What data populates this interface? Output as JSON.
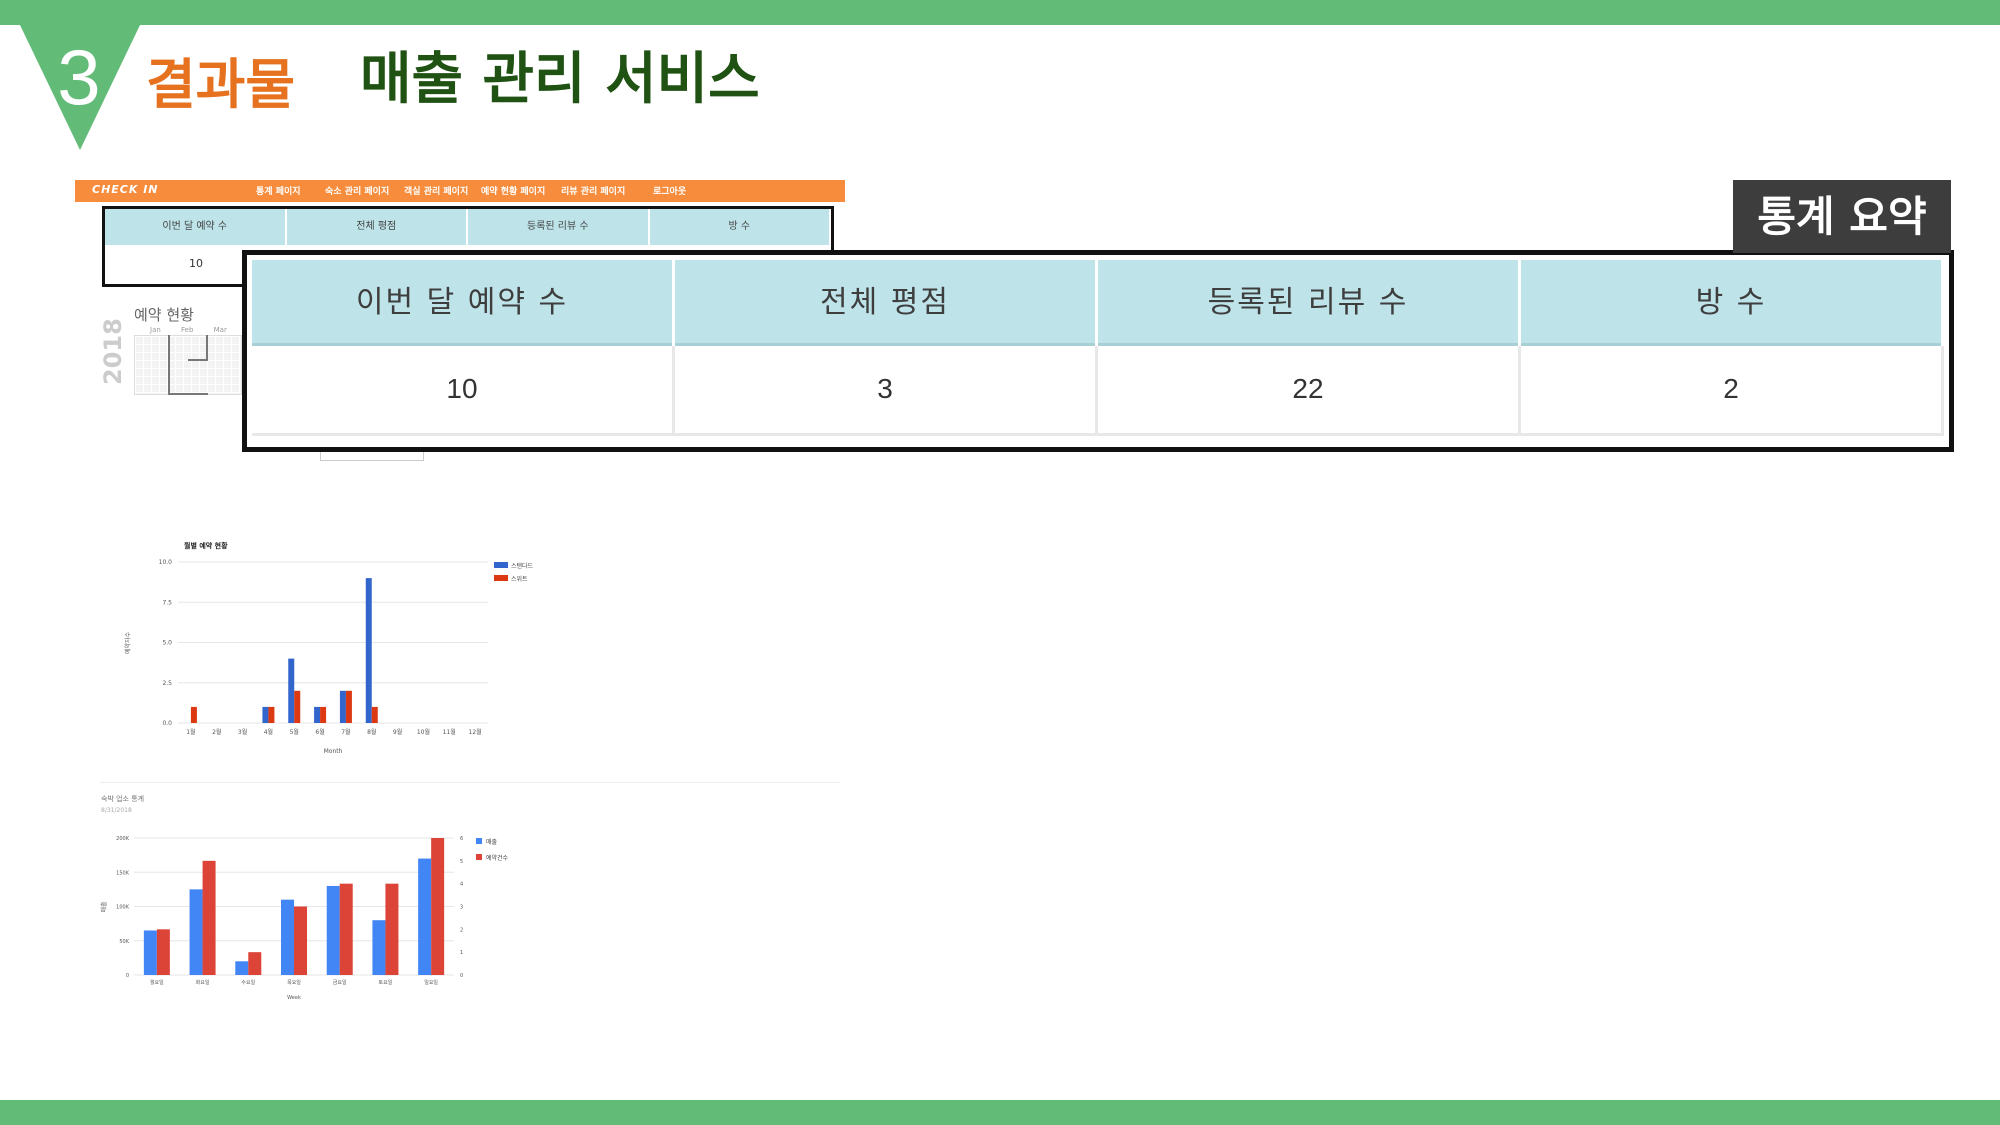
{
  "slide": {
    "number": "3",
    "section_label": "결과물",
    "title": "매출 관리 서비스"
  },
  "colors": {
    "green": "#62bb77",
    "orange": "#e6711f",
    "dark_green": "#1f5213",
    "nav_orange": "#f68c3c",
    "header_blue": "#bee4ea",
    "blue": "#3366cc",
    "red": "#dc3912"
  },
  "mini_app": {
    "logo": "CHECK IN",
    "nav": [
      "통계 페이지",
      "숙소 관리 페이지",
      "객실 관리 페이지",
      "예약 현황 페이지",
      "리뷰 관리 페이지",
      "로그아웃"
    ],
    "stats_headers": [
      "이번 달 예약 수",
      "전체 평점",
      "등록된 리뷰 수",
      "방 수"
    ],
    "stats_first_value": "10",
    "calendar_title": "예약 현황",
    "calendar_year": "2018",
    "calendar_months": "Jan Feb Mar"
  },
  "summary": {
    "label": "통계 요약",
    "headers": [
      "이번 달 예약 수",
      "전체 평점",
      "등록된 리뷰 수",
      "방 수"
    ],
    "values": [
      "10",
      "3",
      "22",
      "2"
    ]
  },
  "chart_data": [
    {
      "type": "bar",
      "title": "월별 예약 현황",
      "xlabel": "Month",
      "ylabel": "예약자수",
      "categories": [
        "1월",
        "2월",
        "3월",
        "4월",
        "5월",
        "6월",
        "7월",
        "8월",
        "9월",
        "10월",
        "11월",
        "12월"
      ],
      "series": [
        {
          "name": "스탠다드",
          "values": [
            0,
            0,
            0,
            1,
            4,
            1,
            2,
            9,
            0,
            0,
            0,
            0
          ]
        },
        {
          "name": "스위트",
          "values": [
            1,
            0,
            0,
            1,
            2,
            1,
            2,
            1,
            0,
            0,
            0,
            0
          ]
        }
      ],
      "ylim": [
        0,
        10
      ],
      "yticks": [
        "0.0",
        "2.5",
        "5.0",
        "7.5",
        "10.0"
      ],
      "legend": "right",
      "grid": true
    },
    {
      "type": "bar",
      "title": "숙박 업소 통계",
      "subtitle": "8/31/2018",
      "xlabel": "Week",
      "ylabel": "매출",
      "categories": [
        "월요일",
        "화요일",
        "수요일",
        "목요일",
        "금요일",
        "토요일",
        "일요일"
      ],
      "series": [
        {
          "name": "매출",
          "values": [
            65000,
            125000,
            20000,
            110000,
            130000,
            80000,
            170000
          ]
        },
        {
          "name": "예약건수",
          "values": [
            2,
            5,
            1,
            3,
            4,
            4,
            6
          ]
        }
      ],
      "ylim": [
        0,
        200000
      ],
      "yticks": [
        "0",
        "50K",
        "100K",
        "150K",
        "200K"
      ],
      "y2lim": [
        0,
        6
      ],
      "y2ticks": [
        "0",
        "1",
        "2",
        "3",
        "4",
        "5",
        "6"
      ],
      "legend": "right",
      "grid": true
    }
  ]
}
